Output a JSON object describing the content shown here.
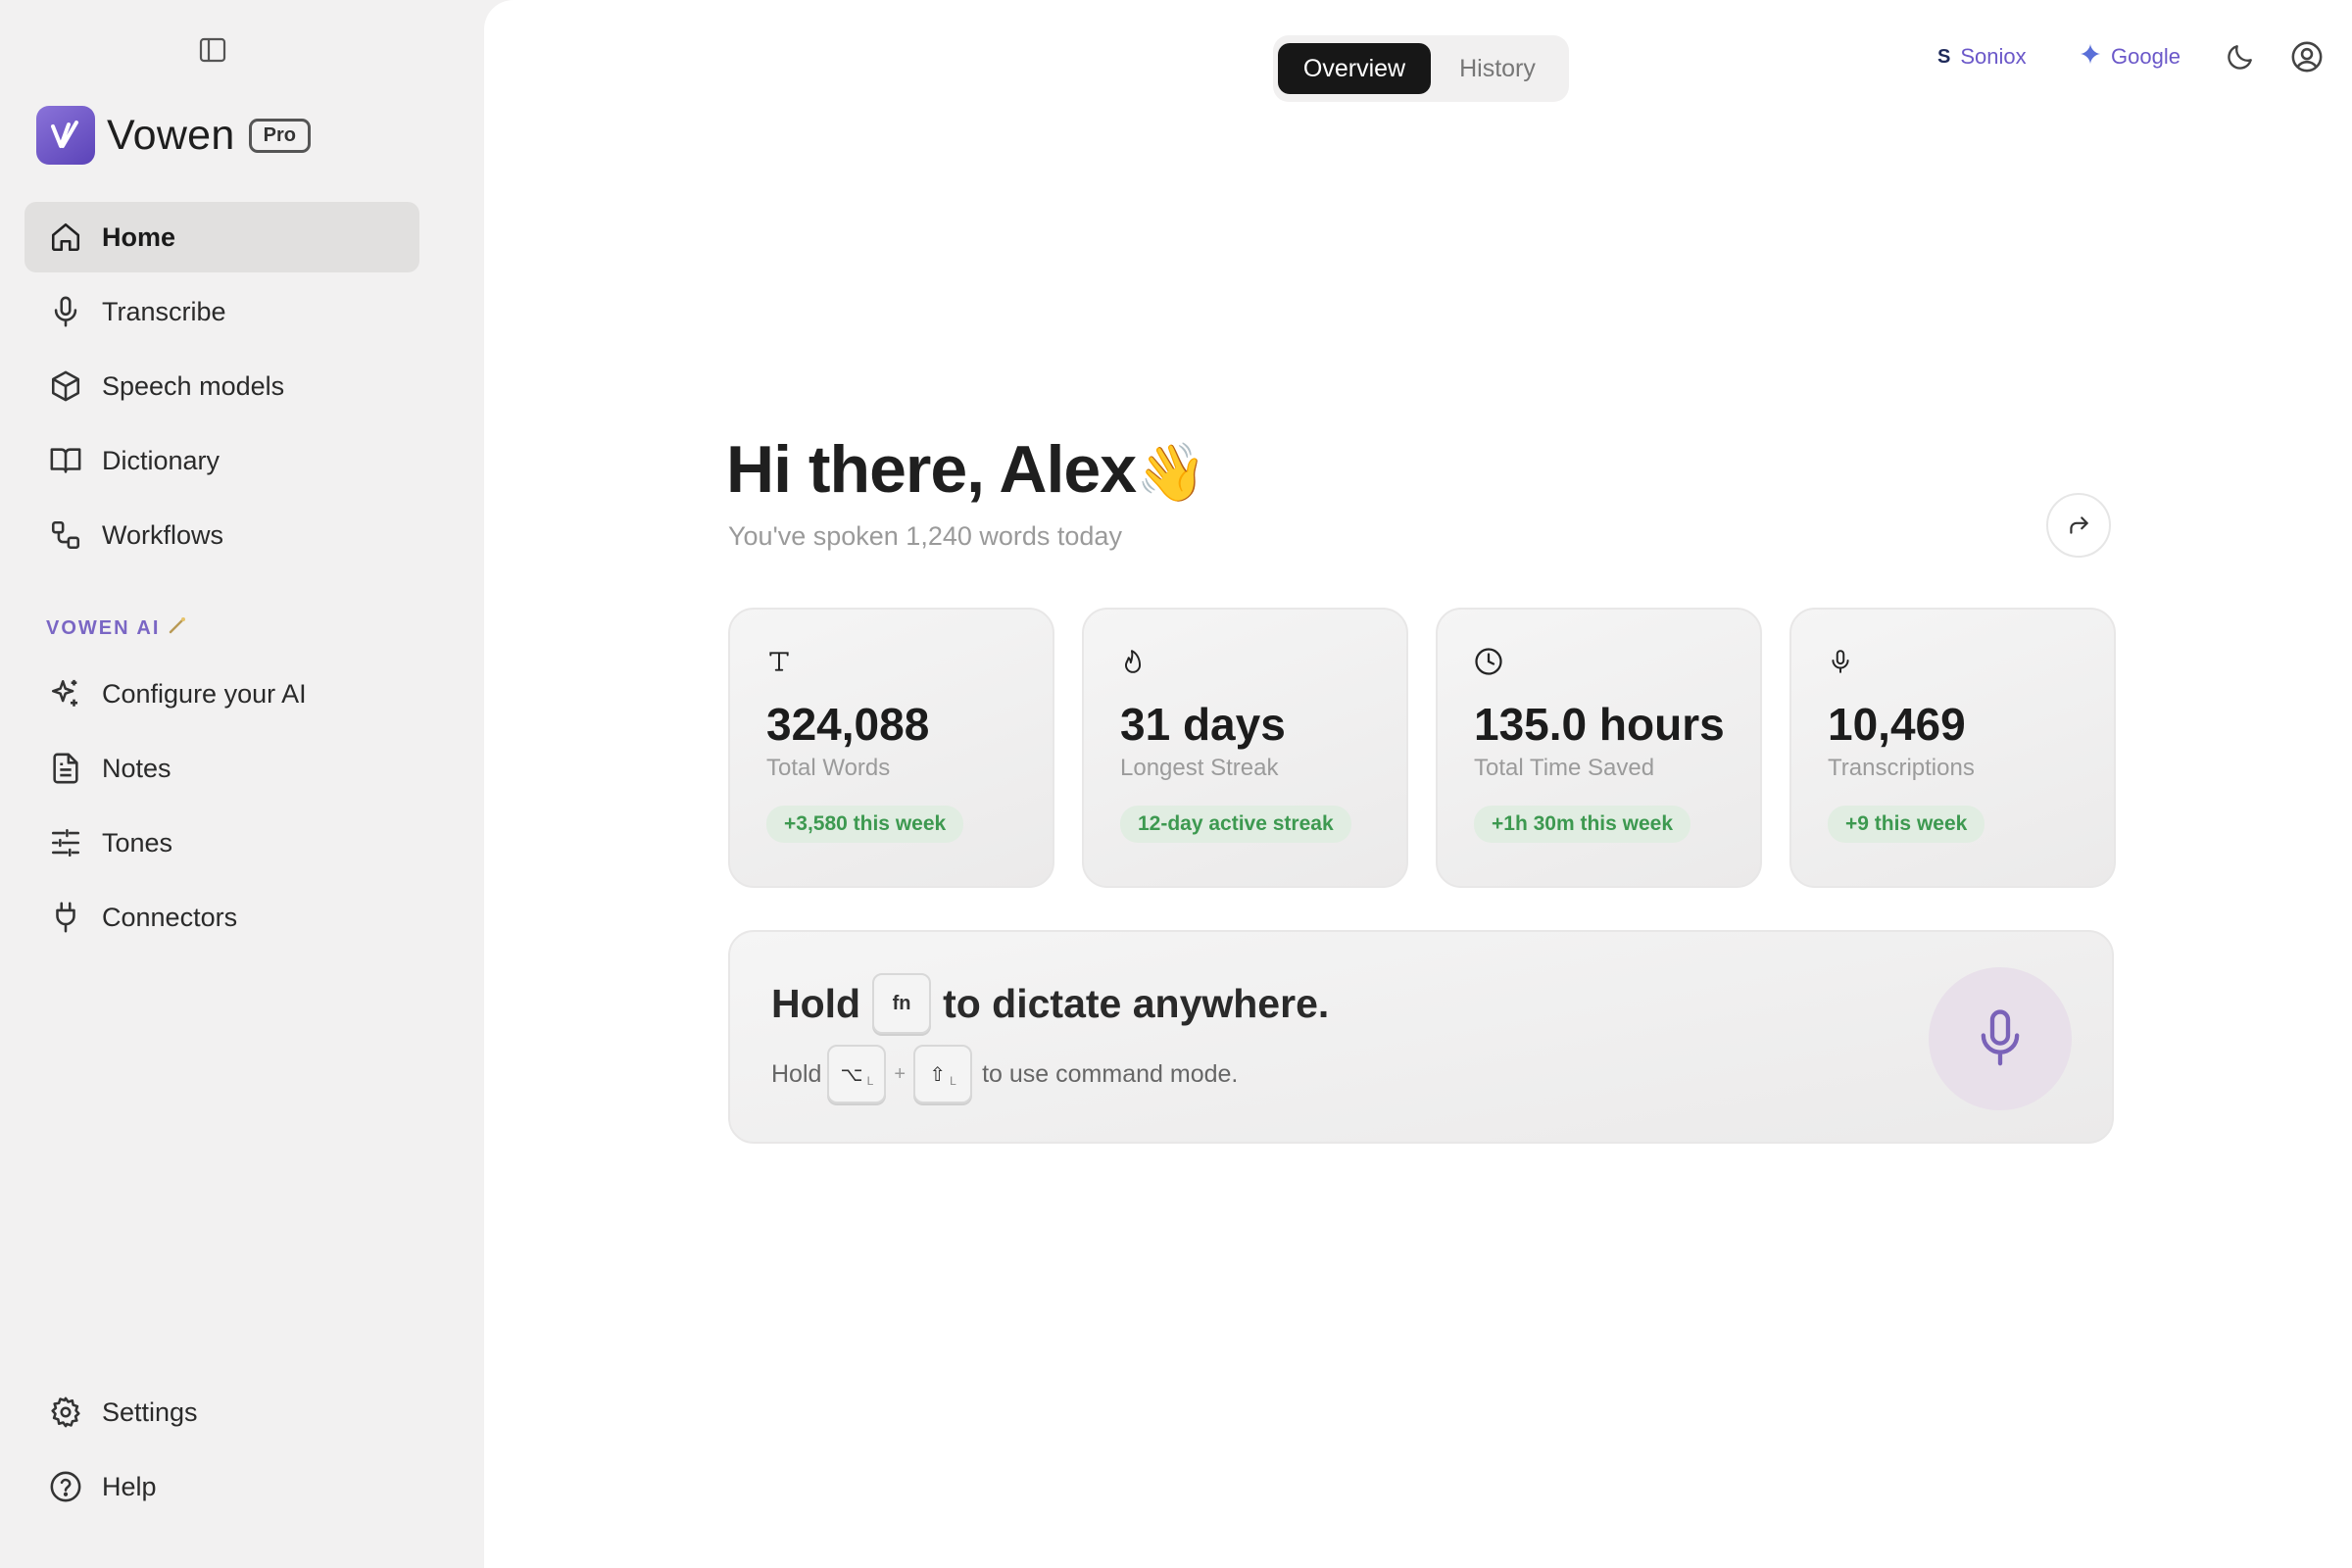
{
  "app": {
    "name": "Vowen",
    "badge": "Pro",
    "accent_color": "#6b58c9"
  },
  "sidebar": {
    "items": [
      {
        "label": "Home",
        "icon": "home-icon",
        "active": true
      },
      {
        "label": "Transcribe",
        "icon": "microphone-icon"
      },
      {
        "label": "Speech models",
        "icon": "cube-icon"
      },
      {
        "label": "Dictionary",
        "icon": "book-icon"
      },
      {
        "label": "Workflows",
        "icon": "workflow-icon"
      }
    ],
    "ai_section_heading": "VOWEN AI",
    "ai_items": [
      {
        "label": "Configure your AI",
        "icon": "sparkles-icon"
      },
      {
        "label": "Notes",
        "icon": "document-icon"
      },
      {
        "label": "Tones",
        "icon": "sliders-icon"
      },
      {
        "label": "Connectors",
        "icon": "plug-icon"
      }
    ],
    "bottom_items": [
      {
        "label": "Settings",
        "icon": "gear-icon"
      },
      {
        "label": "Help",
        "icon": "help-circle-icon"
      }
    ]
  },
  "header": {
    "tabs": [
      {
        "label": "Overview",
        "active": true
      },
      {
        "label": "History",
        "active": false
      }
    ],
    "providers": [
      {
        "label": "Soniox",
        "icon": "soniox-icon"
      },
      {
        "label": "Google",
        "icon": "google-sparkle-icon"
      }
    ],
    "theme_icon": "moon-icon",
    "account_icon": "user-circle-icon"
  },
  "main": {
    "greeting": "Hi there, Alex",
    "greeting_emoji": "👋",
    "subline": "You've spoken 1,240 words today",
    "stats": [
      {
        "icon": "text-icon",
        "value": "324,088",
        "label": "Total Words",
        "badge": "+3,580 this week"
      },
      {
        "icon": "flame-icon",
        "value": "31 days",
        "label": "Longest Streak",
        "badge": "12-day active streak"
      },
      {
        "icon": "clock-icon",
        "value": "135.0 hours",
        "label": "Total Time Saved",
        "badge": "+1h 30m this week"
      },
      {
        "icon": "microphone-icon",
        "value": "10,469",
        "label": "Transcriptions",
        "badge": "+9 this week"
      }
    ],
    "dictate": {
      "title_prefix": "Hold",
      "title_key": "fn",
      "title_suffix": "to dictate anywhere.",
      "sub_prefix": "Hold",
      "sub_key1": "⌥",
      "sub_key1_side": "L",
      "sub_plus": "+",
      "sub_key2": "⇧",
      "sub_key2_side": "L",
      "sub_suffix": "to use command mode."
    }
  }
}
